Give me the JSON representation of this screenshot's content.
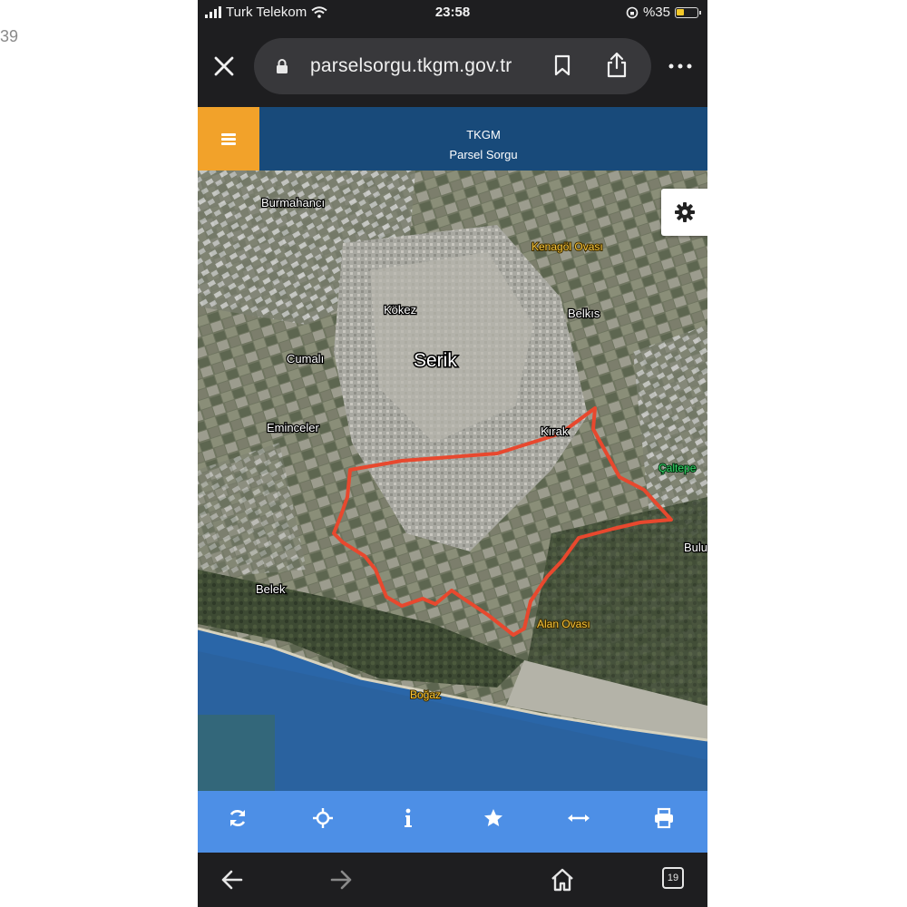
{
  "edge_text": "39",
  "status_bar": {
    "carrier": "Turk Telekom",
    "time": "23:58",
    "battery": "%35",
    "icons": [
      "signal-bars-icon",
      "wifi-icon",
      "orientation-lock-icon",
      "battery-icon"
    ]
  },
  "browser": {
    "url": "parselsorgu.tkgm.gov.tr",
    "icons": [
      "close-icon",
      "lock-icon",
      "bookmark-icon",
      "share-icon",
      "more-icon"
    ]
  },
  "app": {
    "title": "TKGM",
    "subtitle": "Parsel Sorgu",
    "header_color": "#184a7a",
    "menu_color": "#f2a22a"
  },
  "map": {
    "boundary_color": "#e8482e",
    "labels": {
      "burmahanci": "Burmahancı",
      "kenagol": "Kenagöl Ovası",
      "kokez": "Kökez",
      "belkis": "Belkıs",
      "serik": "Serik",
      "cumali": "Cumalı",
      "eminceler": "Eminceler",
      "kirak": "Kırak",
      "belek": "Belek",
      "alan_ovasi": "Alan Ovası",
      "bogaz": "Boğaz",
      "right_green": "Çaltepe",
      "bulu": "Bulu"
    }
  },
  "tool_bar": {
    "color": "#4d8fe6",
    "tools": [
      "refresh-icon",
      "locate-icon",
      "info-icon",
      "favorite-star-icon",
      "measure-icon",
      "print-icon"
    ]
  },
  "nav_bar": {
    "tab_count": "19",
    "icons": [
      "back-arrow-icon",
      "forward-arrow-icon",
      "home-icon",
      "tabs-icon"
    ]
  }
}
